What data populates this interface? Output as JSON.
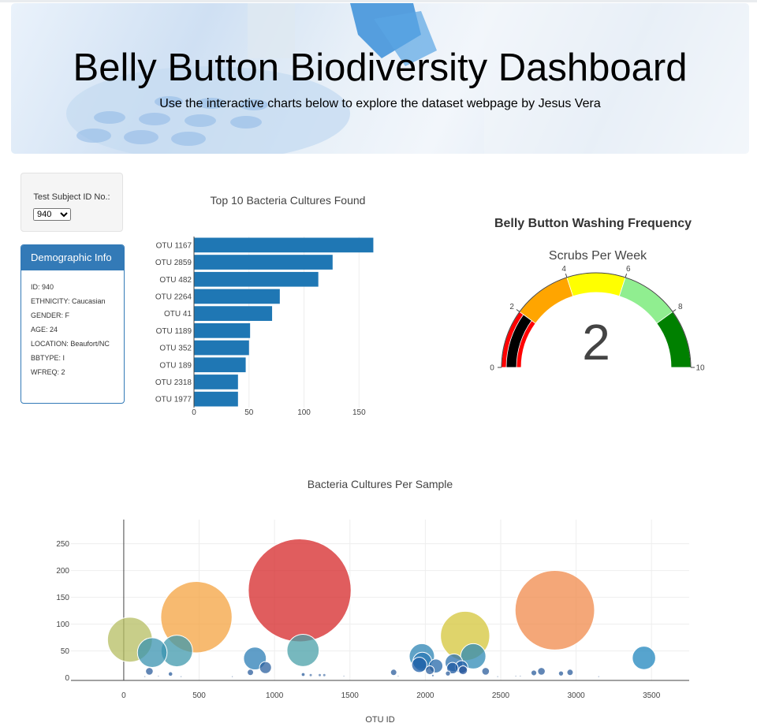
{
  "header": {
    "title": "Belly Button Biodiversity Dashboard",
    "subtitle": "Use the interactive charts below to explore the dataset webpage by Jesus Vera"
  },
  "selector": {
    "label": "Test Subject ID No.:",
    "selected": "940"
  },
  "demographics": {
    "title": "Demographic Info",
    "rows": [
      "ID: 940",
      "ETHNICITY: Caucasian",
      "GENDER: F",
      "AGE: 24",
      "LOCATION: Beaufort/NC",
      "BBTYPE: I",
      "WFREQ: 2"
    ]
  },
  "chart_data": [
    {
      "type": "bar",
      "orientation": "horizontal",
      "title": "Top 10 Bacteria Cultures Found",
      "categories": [
        "OTU 1167",
        "OTU 2859",
        "OTU 482",
        "OTU 2264",
        "OTU 41",
        "OTU 1189",
        "OTU 352",
        "OTU 189",
        "OTU 2318",
        "OTU 1977"
      ],
      "values": [
        163,
        126,
        113,
        78,
        71,
        51,
        50,
        47,
        40,
        40
      ],
      "xticks": [
        0,
        50,
        100,
        150
      ],
      "xlim": [
        0,
        172
      ],
      "color": "#1f77b4"
    },
    {
      "type": "gauge",
      "title": "Belly Button Washing Frequency",
      "subtitle": "Scrubs Per Week",
      "value": 2,
      "value_label": "2",
      "range": [
        0,
        10
      ],
      "ticks": [
        "0",
        "2",
        "4",
        "6",
        "8",
        "10"
      ],
      "steps": [
        {
          "range": [
            0,
            2
          ],
          "color": "#ff0000"
        },
        {
          "range": [
            2,
            4
          ],
          "color": "#ffa500"
        },
        {
          "range": [
            4,
            6
          ],
          "color": "#ffff00"
        },
        {
          "range": [
            6,
            8
          ],
          "color": "#90ee90"
        },
        {
          "range": [
            8,
            10
          ],
          "color": "#008000"
        }
      ],
      "bar_color": "#000000"
    },
    {
      "type": "scatter",
      "title": "Bacteria Cultures Per Sample",
      "xlabel": "OTU ID",
      "xticks": [
        0,
        500,
        1000,
        1500,
        2000,
        2500,
        3000,
        3500
      ],
      "yticks": [
        0,
        50,
        100,
        150,
        200,
        250
      ],
      "xlim": [
        -350,
        3750
      ],
      "ylim": [
        -5,
        295
      ],
      "points": [
        {
          "x": 1167,
          "y": 163,
          "c": "#d62728"
        },
        {
          "x": 2859,
          "y": 126,
          "c": "#f08a4b"
        },
        {
          "x": 482,
          "y": 113,
          "c": "#f4a340"
        },
        {
          "x": 2264,
          "y": 78,
          "c": "#d4c53a"
        },
        {
          "x": 41,
          "y": 71,
          "c": "#b5bd62"
        },
        {
          "x": 1189,
          "y": 51,
          "c": "#4aa0a8"
        },
        {
          "x": 352,
          "y": 50,
          "c": "#3f98ac"
        },
        {
          "x": 189,
          "y": 47,
          "c": "#3a93b0"
        },
        {
          "x": 2318,
          "y": 40,
          "c": "#2d8ab5"
        },
        {
          "x": 1977,
          "y": 40,
          "c": "#2c84b4"
        },
        {
          "x": 3450,
          "y": 37,
          "c": "#1f86be"
        },
        {
          "x": 870,
          "y": 36,
          "c": "#2b7db6"
        },
        {
          "x": 1980,
          "y": 30,
          "c": "#2b78b4"
        },
        {
          "x": 2190,
          "y": 28,
          "c": "#2b70ae"
        },
        {
          "x": 1960,
          "y": 24,
          "c": "#1f5fa8"
        },
        {
          "x": 2070,
          "y": 22,
          "c": "#2668aa"
        },
        {
          "x": 2240,
          "y": 20,
          "c": "#1f5ea6"
        },
        {
          "x": 2180,
          "y": 18,
          "c": "#1f5aa2"
        },
        {
          "x": 940,
          "y": 19,
          "c": "#2b609f"
        },
        {
          "x": 2030,
          "y": 14,
          "c": "#2a5d9c"
        },
        {
          "x": 2250,
          "y": 14,
          "c": "#24539a"
        },
        {
          "x": 2400,
          "y": 12,
          "c": "#2c5e9c"
        },
        {
          "x": 2770,
          "y": 12,
          "c": "#2c5e9c"
        },
        {
          "x": 170,
          "y": 12,
          "c": "#2c5e9c"
        },
        {
          "x": 1790,
          "y": 10,
          "c": "#2c5e9c"
        },
        {
          "x": 2960,
          "y": 10,
          "c": "#2c5e9c"
        },
        {
          "x": 2720,
          "y": 9,
          "c": "#2c5e9c"
        },
        {
          "x": 840,
          "y": 10,
          "c": "#2c5e9c"
        },
        {
          "x": 2150,
          "y": 8,
          "c": "#2c5e9c"
        },
        {
          "x": 2900,
          "y": 8,
          "c": "#2c5e9c"
        },
        {
          "x": 310,
          "y": 7,
          "c": "#2c5e9c"
        },
        {
          "x": 1190,
          "y": 6,
          "c": "#2c5e9c"
        },
        {
          "x": 1300,
          "y": 5,
          "c": "#5a7fb0"
        },
        {
          "x": 1330,
          "y": 5,
          "c": "#5a7fb0"
        },
        {
          "x": 1240,
          "y": 5,
          "c": "#5a7fb0"
        },
        {
          "x": 2050,
          "y": 4,
          "c": "#5a7fb0"
        },
        {
          "x": 2600,
          "y": 3,
          "c": "#8aa0c0"
        },
        {
          "x": 2630,
          "y": 3,
          "c": "#8aa0c0"
        },
        {
          "x": 1460,
          "y": 3,
          "c": "#8aa0c0"
        },
        {
          "x": 1820,
          "y": 3,
          "c": "#8aa0c0"
        },
        {
          "x": 230,
          "y": 3,
          "c": "#8aa0c0"
        },
        {
          "x": 140,
          "y": 2,
          "c": "#8aa0c0"
        },
        {
          "x": 380,
          "y": 2,
          "c": "#8aa0c0"
        },
        {
          "x": 720,
          "y": 2,
          "c": "#8aa0c0"
        },
        {
          "x": 2480,
          "y": 2,
          "c": "#8aa0c0"
        },
        {
          "x": 3150,
          "y": 2,
          "c": "#8aa0c0"
        }
      ]
    }
  ]
}
